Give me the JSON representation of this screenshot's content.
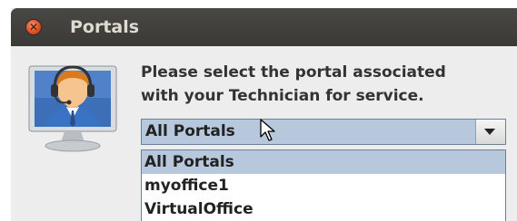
{
  "window": {
    "title": "Portals",
    "close_icon": "close-icon"
  },
  "dialog": {
    "avatar_icon": "support-agent-headset-icon",
    "prompt": "Please select the portal associated\nwith your Technician for service."
  },
  "portal_select": {
    "value": "All Portals",
    "arrow_icon": "chevron-down-icon",
    "options": [
      {
        "label": "All Portals",
        "selected": true
      },
      {
        "label": "myoffice1",
        "selected": false
      },
      {
        "label": "VirtualOffice",
        "selected": false
      }
    ]
  },
  "colors": {
    "titlebar": "#3f3e3a",
    "title_text": "#dfdbd2",
    "close_button": "#de4c20",
    "selection": "#b8c8dc",
    "dialog_bg": "#ededed"
  }
}
